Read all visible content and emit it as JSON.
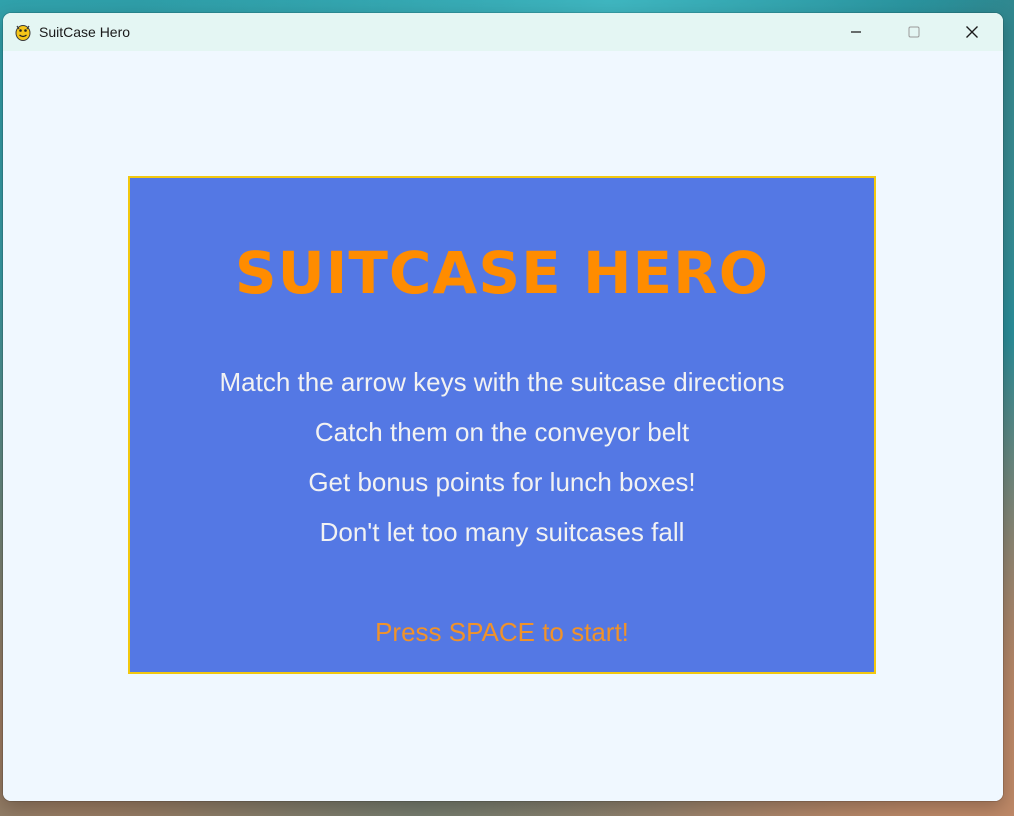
{
  "window": {
    "title": "SuitCase Hero",
    "controls": {
      "minimize_icon": "minimize-icon",
      "maximize_icon": "maximize-icon",
      "close_icon": "close-icon"
    }
  },
  "game": {
    "title": "SUITCASE HERO",
    "instructions": [
      "Match the arrow keys with the suitcase directions",
      "Catch them on the conveyor belt",
      "Get bonus points for lunch boxes!",
      "Don't let too many suitcases fall"
    ],
    "start_prompt": "Press SPACE to start!"
  },
  "colors": {
    "background": "#f0f8ff",
    "panel": "#5478e4",
    "panel_border": "#f2c80f",
    "title": "#ff8c00",
    "instructions": "#f2f2f2",
    "start_prompt": "#f0922a"
  }
}
